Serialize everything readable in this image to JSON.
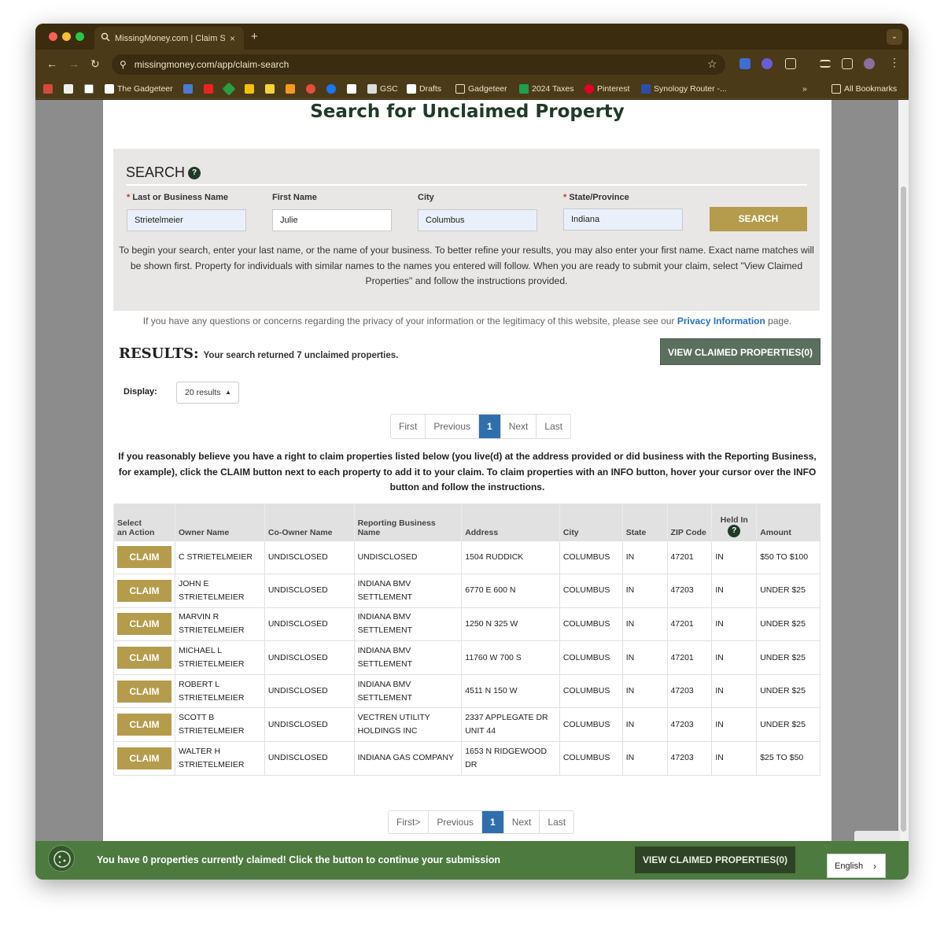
{
  "browser": {
    "tab_title": "MissingMoney.com | Claim Se",
    "tab_close": "×",
    "new_tab": "+",
    "tab_menu": "⌄",
    "url": "missingmoney.com/app/claim-search",
    "bookmarks": [
      {
        "label": "The Gadgeteer"
      },
      {
        "label": "GSC"
      },
      {
        "label": "Drafts"
      },
      {
        "label": "Gadgeteer"
      },
      {
        "label": "2024 Taxes"
      },
      {
        "label": "Pinterest"
      },
      {
        "label": "Synology Router -..."
      }
    ],
    "more": "»",
    "all_bookmarks": "All Bookmarks",
    "colors": {
      "frame": "#3b2c10",
      "toolbar": "#4b3a18"
    }
  },
  "page": {
    "title": "Search for Unclaimed Property",
    "search": {
      "heading": "SEARCH",
      "help": "?",
      "required_mark": "*",
      "fields": [
        {
          "label": "Last or Business Name",
          "required": true,
          "value": "Strietelmeier"
        },
        {
          "label": "First Name",
          "required": false,
          "value": "Julie"
        },
        {
          "label": "City",
          "required": false,
          "value": "Columbus"
        },
        {
          "label": "State/Province",
          "required": true,
          "value": "Indiana"
        }
      ],
      "button": "SEARCH",
      "description": "To begin your search, enter your last name, or the name of your business.  To better refine your results, you may also enter your first name.  Exact name matches will be shown first.  Property for individuals with similar names to the names you entered will follow.  When you are ready to submit your claim, select \"View Claimed Properties\" and follow the instructions provided."
    },
    "privacy": {
      "before": "If you have any questions or concerns regarding the privacy of your information or the legitimacy of this website, please see our ",
      "link": "Privacy Information",
      "after": " page."
    },
    "results": {
      "heading": "RESULTS:",
      "summary": "Your search returned 7 unclaimed properties.",
      "view_claimed": "VIEW CLAIMED PROPERTIES(0)",
      "display_label": "Display:",
      "display_value": "20 results",
      "pager_top": [
        "First",
        "Previous",
        "1",
        "Next",
        "Last"
      ],
      "pager_bottom": [
        "First>",
        "Previous",
        "1",
        "Next",
        "Last"
      ],
      "instructions": "If you reasonably believe you have a right to claim properties listed below (you live(d) at the address provided or did business with the Reporting Business, for example), click the CLAIM button next to each property to add it to your claim. To claim properties with an INFO button, hover your cursor over the INFO button and follow the instructions."
    },
    "table": {
      "headers": {
        "select": [
          "Select",
          "an Action"
        ],
        "owner": "Owner Name",
        "coowner": "Co-Owner Name",
        "reporting": [
          "Reporting Business",
          "Name"
        ],
        "address": "Address",
        "city": "City",
        "state": "State",
        "zip": "ZIP Code",
        "held": "Held In",
        "held_help": "?",
        "amount": "Amount"
      },
      "claim_label": "CLAIM",
      "rows": [
        {
          "owner": [
            "C STRIETELMEIER"
          ],
          "coowner": "UNDISCLOSED",
          "reporting": [
            "UNDISCLOSED"
          ],
          "address": [
            "1504 RUDDICK"
          ],
          "city": "COLUMBUS",
          "state": "IN",
          "zip": "47201",
          "held": "IN",
          "amount": "$50 TO $100"
        },
        {
          "owner": [
            "JOHN E",
            "STRIETELMEIER"
          ],
          "coowner": "UNDISCLOSED",
          "reporting": [
            "INDIANA BMV",
            "SETTLEMENT"
          ],
          "address": [
            "6770 E 600 N"
          ],
          "city": "COLUMBUS",
          "state": "IN",
          "zip": "47203",
          "held": "IN",
          "amount": "UNDER $25"
        },
        {
          "owner": [
            "MARVIN R",
            "STRIETELMEIER"
          ],
          "coowner": "UNDISCLOSED",
          "reporting": [
            "INDIANA BMV",
            "SETTLEMENT"
          ],
          "address": [
            "1250 N 325 W"
          ],
          "city": "COLUMBUS",
          "state": "IN",
          "zip": "47201",
          "held": "IN",
          "amount": "UNDER $25"
        },
        {
          "owner": [
            "MICHAEL L",
            "STRIETELMEIER"
          ],
          "coowner": "UNDISCLOSED",
          "reporting": [
            "INDIANA BMV",
            "SETTLEMENT"
          ],
          "address": [
            "11760 W 700 S"
          ],
          "city": "COLUMBUS",
          "state": "IN",
          "zip": "47201",
          "held": "IN",
          "amount": "UNDER $25"
        },
        {
          "owner": [
            "ROBERT L",
            "STRIETELMEIER"
          ],
          "coowner": "UNDISCLOSED",
          "reporting": [
            "INDIANA BMV",
            "SETTLEMENT"
          ],
          "address": [
            "4511 N 150 W"
          ],
          "city": "COLUMBUS",
          "state": "IN",
          "zip": "47203",
          "held": "IN",
          "amount": "UNDER $25"
        },
        {
          "owner": [
            "SCOTT B",
            "STRIETELMEIER"
          ],
          "coowner": "UNDISCLOSED",
          "reporting": [
            "VECTREN UTILITY",
            "HOLDINGS INC"
          ],
          "address": [
            "2337 APPLEGATE DR",
            "UNIT 44"
          ],
          "city": "COLUMBUS",
          "state": "IN",
          "zip": "47203",
          "held": "IN",
          "amount": "UNDER $25"
        },
        {
          "owner": [
            "WALTER H",
            "STRIETELMEIER"
          ],
          "coowner": "UNDISCLOSED",
          "reporting": [
            "INDIANA GAS COMPANY"
          ],
          "address": [
            "1653 N RIDGEWOOD DR"
          ],
          "city": "COLUMBUS",
          "state": "IN",
          "zip": "47203",
          "held": "IN",
          "amount": "$25 TO $50"
        }
      ]
    },
    "banner": {
      "text": "You have 0 properties currently claimed! Click the button to continue your submission",
      "button": "VIEW CLAIMED PROPERTIES(0)",
      "language": "English"
    },
    "colors": {
      "gold": "#b59b4c",
      "green_dark": "#1f3a28",
      "banner": "#4c7a3f",
      "link": "#2a72c4"
    }
  }
}
